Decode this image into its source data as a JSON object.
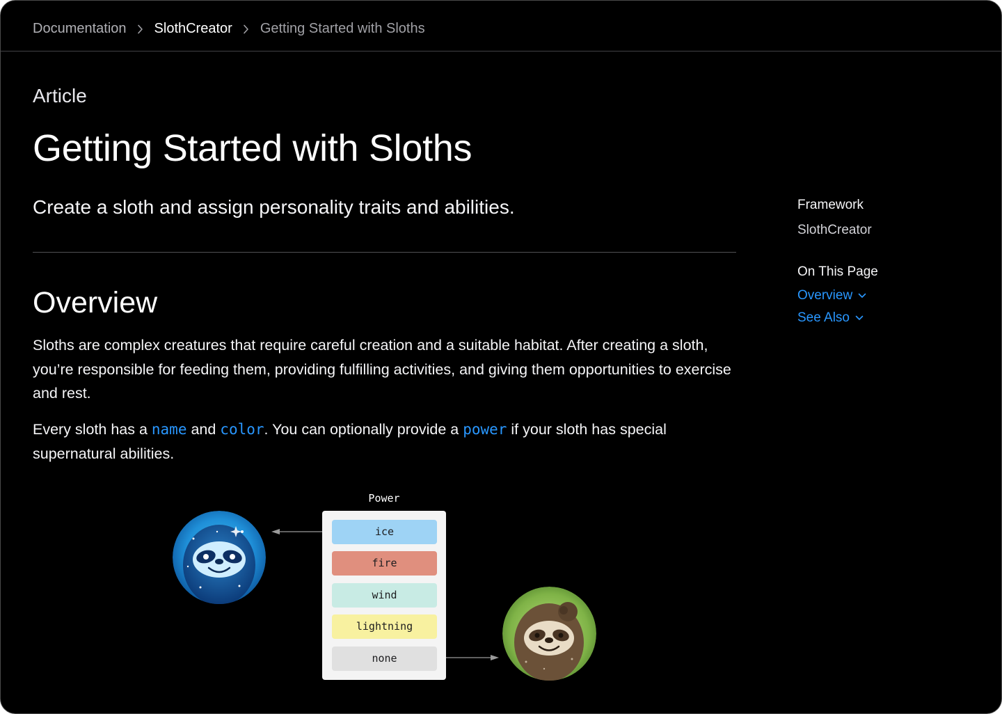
{
  "breadcrumb": {
    "items": [
      {
        "label": "Documentation"
      },
      {
        "label": "SlothCreator"
      },
      {
        "label": "Getting Started with Sloths"
      }
    ]
  },
  "header": {
    "eyebrow": "Article",
    "title": "Getting Started with Sloths",
    "abstract": "Create a sloth and assign personality traits and abilities."
  },
  "overview": {
    "heading": "Overview",
    "paragraph1": "Sloths are complex creatures that require careful creation and a suitable habitat. After creating a sloth, you’re responsible for feeding them, providing fulfilling activities, and giving them opportunities to exercise and rest.",
    "paragraph2": {
      "part1": "Every sloth has a ",
      "code1": "name",
      "part2": " and ",
      "code2": "color",
      "part3": ". You can optionally provide a ",
      "code3": "power",
      "part4": " if your sloth has special supernatural abilities."
    }
  },
  "sidebar": {
    "framework_heading": "Framework",
    "framework_value": "SlothCreator",
    "on_this_page_heading": "On This Page",
    "links": [
      {
        "label": "Overview"
      },
      {
        "label": "See Also"
      }
    ]
  },
  "figure": {
    "power_label": "Power",
    "options": [
      {
        "label": "ice",
        "color": "#9ed3f5"
      },
      {
        "label": "fire",
        "color": "#e08f7e"
      },
      {
        "label": "wind",
        "color": "#c8ebe4"
      },
      {
        "label": "lightning",
        "color": "#f8f1a0"
      },
      {
        "label": "none",
        "color": "#e0e0e0"
      }
    ],
    "icons": [
      "ice-sloth-avatar-icon",
      "plain-sloth-avatar-icon"
    ]
  },
  "colors": {
    "background": "#000000",
    "link": "#2997ff",
    "text": "#f5f5f7",
    "divider": "#515154"
  }
}
